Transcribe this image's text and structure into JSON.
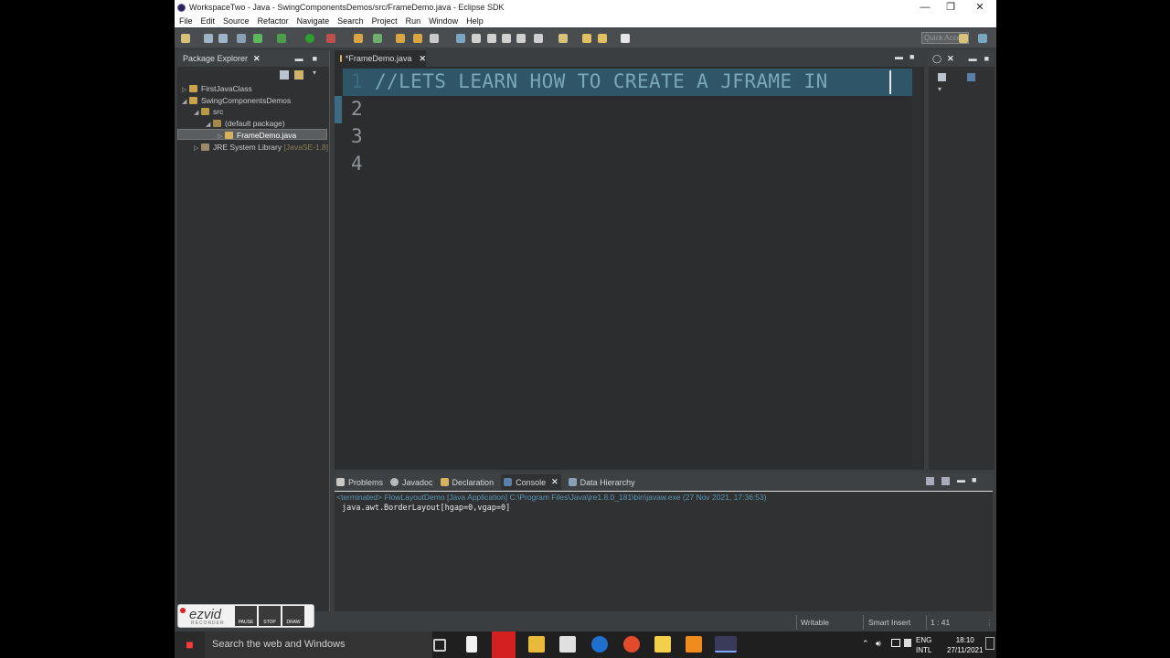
{
  "window": {
    "title": "WorkspaceTwo - Java - SwingComponentsDemos/src/FrameDemo.java - Eclipse SDK",
    "minimize": "—",
    "maximize": "❐",
    "close": "✕"
  },
  "menu": [
    "File",
    "Edit",
    "Source",
    "Refactor",
    "Navigate",
    "Search",
    "Project",
    "Run",
    "Window",
    "Help"
  ],
  "toolbar": {
    "quick_access_placeholder": "Quick Access"
  },
  "package_explorer": {
    "title": "Package Explorer",
    "items": [
      {
        "label": "FirstJavaClass",
        "suffix": ""
      },
      {
        "label": "SwingComponentsDemos",
        "suffix": ""
      },
      {
        "label": "src",
        "suffix": ""
      },
      {
        "label": "(default package)",
        "suffix": ""
      },
      {
        "label": "FrameDemo.java",
        "suffix": ""
      },
      {
        "label": "JRE System Library",
        "suffix": "[JavaSE-1.8]"
      }
    ]
  },
  "editor": {
    "tab_label": "*FrameDemo.java",
    "line_numbers": [
      "1",
      "2",
      "3",
      "4"
    ],
    "code_line_1": "//LETS LEARN  HOW TO CREATE A JFRAME IN"
  },
  "console": {
    "tabs": [
      "Problems",
      "Javadoc",
      "Declaration",
      "Console",
      "Data Hierarchy"
    ],
    "terminated_line": "<terminated> FlowLayoutDemo [Java Application] C:\\Program Files\\Java\\jre1.8.0_181\\bin\\javaw.exe (27 Nov 2021, 17:36:53)",
    "output": "java.awt.BorderLayout[hgap=0,vgap=0]"
  },
  "status": {
    "writable": "Writable",
    "insert_mode": "Smart Insert",
    "position": "1 : 41"
  },
  "ezvid": {
    "logo": "ezvid",
    "subtitle": "RECORDER",
    "pause": "PAUSE",
    "stop": "STOP",
    "draw": "DRAW"
  },
  "taskbar": {
    "search_placeholder": "Search the web and Windows",
    "lang_line1": "ENG",
    "lang_line2": "INTL",
    "time": "18:10",
    "date": "27/11/2021"
  },
  "colors": {
    "editor_bg": "#2b2d2f",
    "line_highlight": "#2f5668",
    "code_comment": "#7aa8b8",
    "terminated": "#5b97b5"
  }
}
